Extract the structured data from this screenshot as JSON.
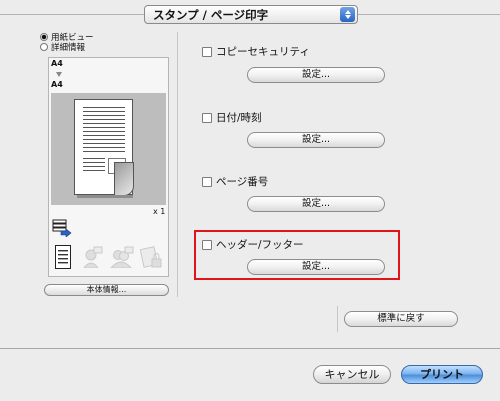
{
  "header": {
    "dropdown_label": "スタンプ / ページ印字"
  },
  "left_panel": {
    "view_options": [
      {
        "label": "用紙ビュー",
        "selected": true
      },
      {
        "label": "詳細情報",
        "selected": false
      }
    ],
    "paper_size_from": "A4",
    "paper_size_to": "A4",
    "copies": "x 1",
    "icons": [
      "printer-tray-icon",
      "document-icon",
      "user-icon",
      "users-icon",
      "secure-document-icon"
    ],
    "device_info_button": "本体情報..."
  },
  "options": [
    {
      "label": "コピーセキュリティ",
      "checked": false,
      "button": "設定..."
    },
    {
      "label": "日付/時刻",
      "checked": false,
      "button": "設定..."
    },
    {
      "label": "ページ番号",
      "checked": false,
      "button": "設定..."
    },
    {
      "label": "ヘッダー/フッター",
      "checked": false,
      "button": "設定..."
    }
  ],
  "reset_button": "標準に戻す",
  "footer": {
    "cancel": "キャンセル",
    "print": "プリント"
  },
  "colors": {
    "highlight": "#e0151a",
    "primary_button": "#4f8fd8",
    "background": "#ececec"
  }
}
